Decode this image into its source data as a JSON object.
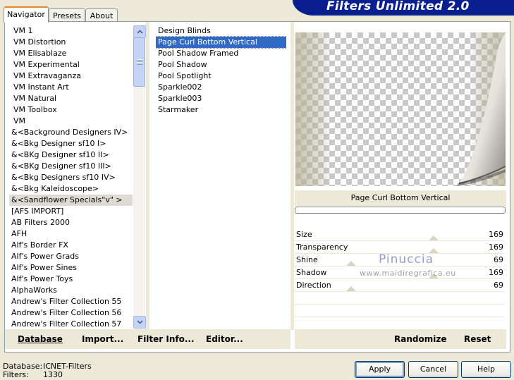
{
  "tabs": [
    "Navigator",
    "Presets",
    "About"
  ],
  "header_title": "Filters Unlimited 2.0",
  "categories": [
    "VM 1",
    "VM Distortion",
    "VM Elisablaze",
    "VM Experimental",
    "VM Extravaganza",
    "VM Instant Art",
    "VM Natural",
    "VM Toolbox",
    "VM",
    "&<Background Designers IV>",
    "&<Bkg Designer sf10 I>",
    "&<BKg Designer sf10 II>",
    "&<BKg Designer sf10 III>",
    "&<Bkg Designers sf10 IV>",
    "&<Bkg Kaleidoscope>",
    "&<Sandflower Specials\"v\" >",
    "[AFS IMPORT]",
    "AB Filters 2000",
    "AFH",
    "Alf's Border FX",
    "Alf's Power Grads",
    "Alf's Power Sines",
    "Alf's Power Toys",
    "AlphaWorks",
    "Andrew's Filter Collection 55",
    "Andrew's Filter Collection 56",
    "Andrew's Filter Collection 57"
  ],
  "filters": [
    "Design Blinds",
    "Page Curl Bottom Vertical",
    "Pool Shadow Framed",
    "Pool Shadow",
    "Pool Spotlight",
    "Sparkle002",
    "Sparkle003",
    "Starmaker"
  ],
  "selected_filter": "Page Curl Bottom Vertical",
  "params": [
    {
      "label": "Size",
      "value": "169",
      "level": 0.66
    },
    {
      "label": "Transparency",
      "value": "169",
      "level": 0.66
    },
    {
      "label": "Shine",
      "value": "69",
      "level": 0.27
    },
    {
      "label": "Shadow",
      "value": "169",
      "level": 0.66
    },
    {
      "label": "Direction",
      "value": "69",
      "level": 0.27
    }
  ],
  "watermark": {
    "name": "Pinuccia",
    "url": "www.maidiregrafica.eu"
  },
  "links_left": [
    "Database",
    "Import...",
    "Filter Info...",
    "Editor..."
  ],
  "links_right": [
    "Randomize",
    "Reset"
  ],
  "status": {
    "database_label": "Database:",
    "database_value": "ICNET-Filters",
    "filters_label": "Filters:",
    "filters_value": "1330"
  },
  "buttons": {
    "apply": "Apply",
    "cancel": "Cancel",
    "help": "Help"
  }
}
